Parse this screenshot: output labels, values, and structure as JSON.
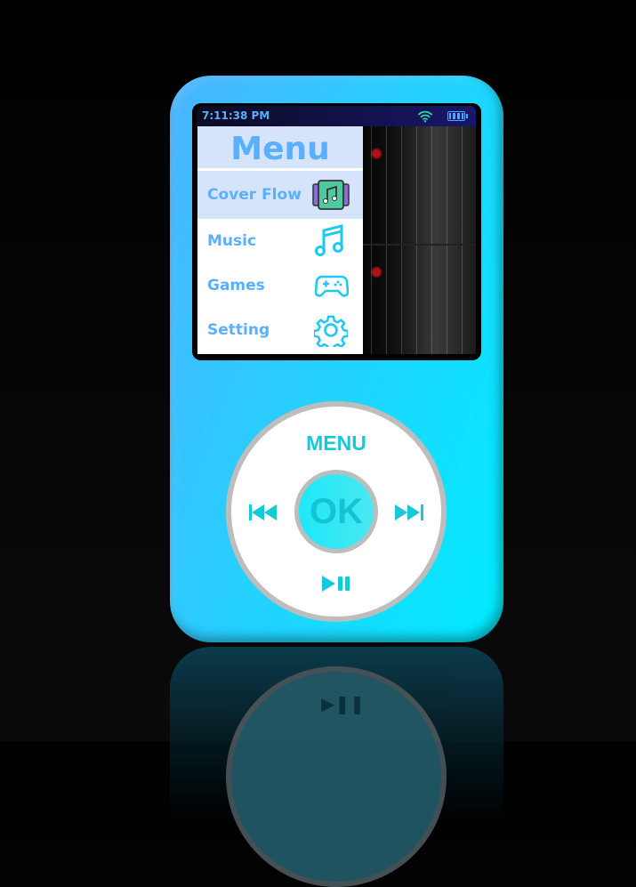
{
  "status": {
    "time": "7:11:38 PM",
    "wifi_icon": "wifi-icon",
    "battery_icon": "battery-icon"
  },
  "menu": {
    "title": "Menu",
    "items": [
      {
        "label": "Cover Flow",
        "icon": "cover-flow-icon",
        "selected": true
      },
      {
        "label": "Music",
        "icon": "music-note-icon"
      },
      {
        "label": "Games",
        "icon": "gamepad-icon"
      },
      {
        "label": "Setting",
        "icon": "gear-icon"
      }
    ]
  },
  "wheel": {
    "menu_label": "MENU",
    "ok_label": "OK"
  },
  "colors": {
    "accent": "#5ab0ff",
    "wheel_text": "#17c8d8",
    "body_left": "#4ab4ff",
    "body_right": "#00ecff"
  }
}
